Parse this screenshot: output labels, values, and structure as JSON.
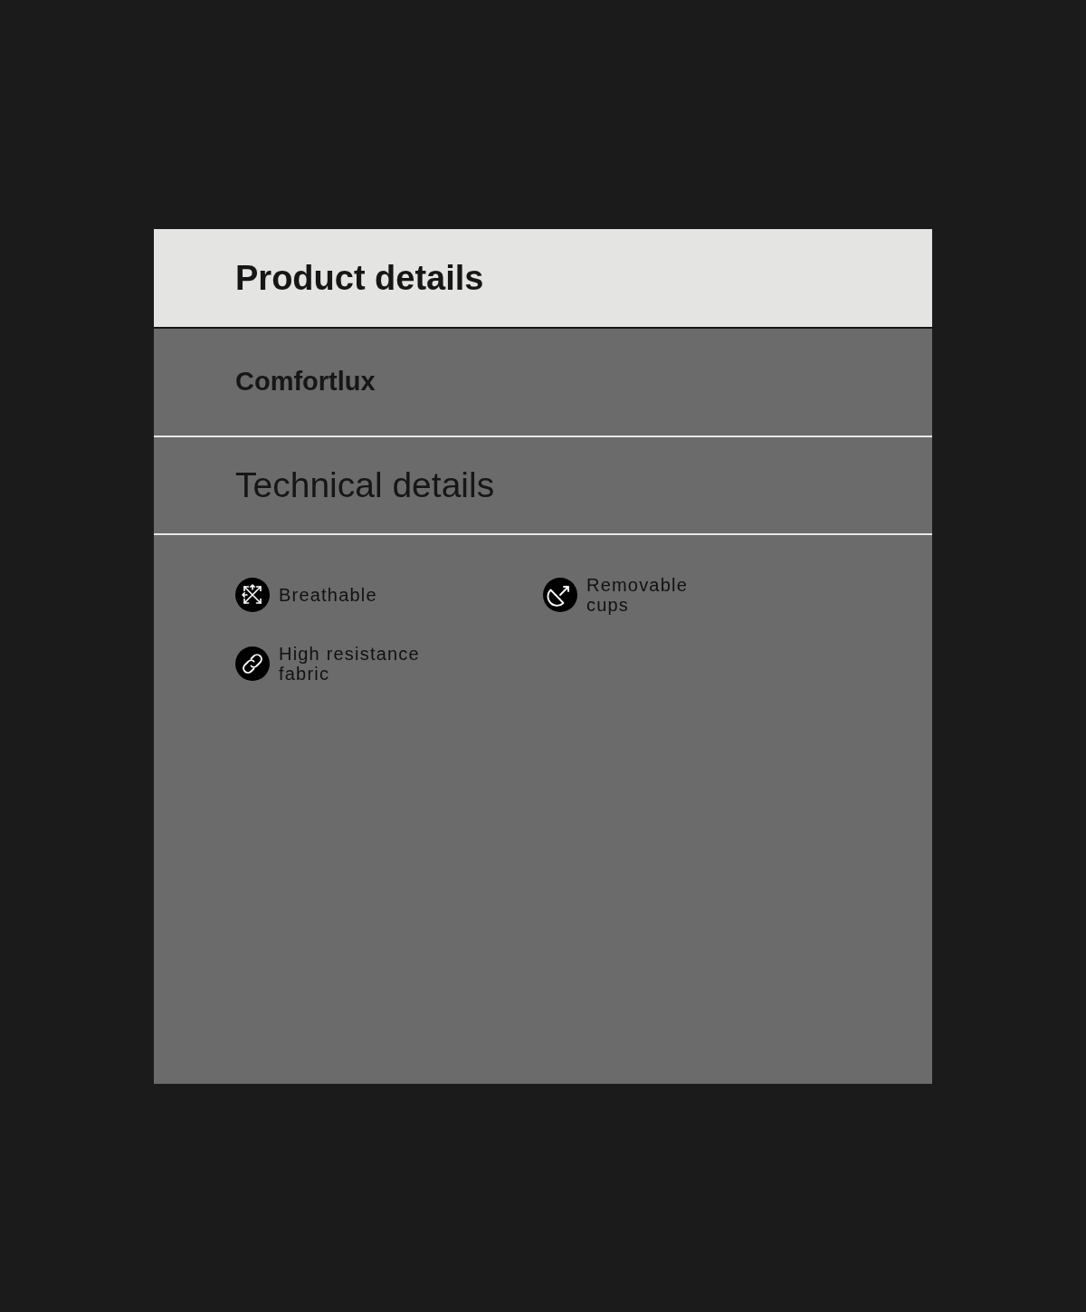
{
  "header": {
    "title": "Product details"
  },
  "product": {
    "name": "Comfortlux"
  },
  "section": {
    "title": "Technical details"
  },
  "features": [
    {
      "kind": "breathable",
      "label": "Breathable"
    },
    {
      "kind": "cups",
      "label": "Removable\ncups"
    },
    {
      "kind": "link",
      "label": "High resistance\nfabric"
    }
  ]
}
